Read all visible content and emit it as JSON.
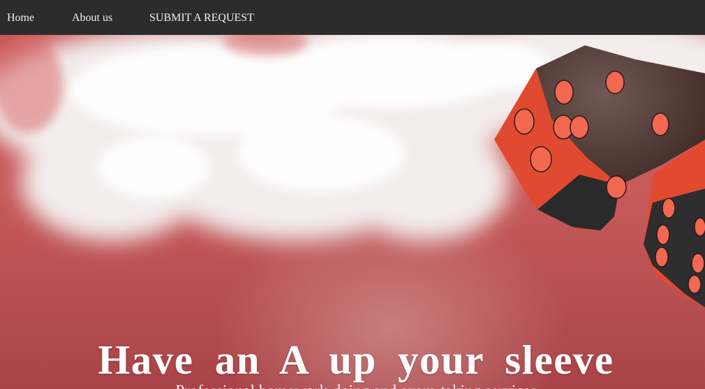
{
  "nav": {
    "items": [
      {
        "label": "Home"
      },
      {
        "label": "About us"
      },
      {
        "label": "SUBMIT A REQUEST"
      }
    ]
  },
  "hero": {
    "headline": "Have an A up your sleeve",
    "subheadline": "Professional homework-doing and exam-taking services",
    "background_image": "clouds-and-red-dice",
    "colors": {
      "navbar": "#2c2c2c",
      "hero_base": "#c55556",
      "dice_red": "#e24a30",
      "dice_dark": "#2e2e2e",
      "pip": "#f26850"
    }
  }
}
